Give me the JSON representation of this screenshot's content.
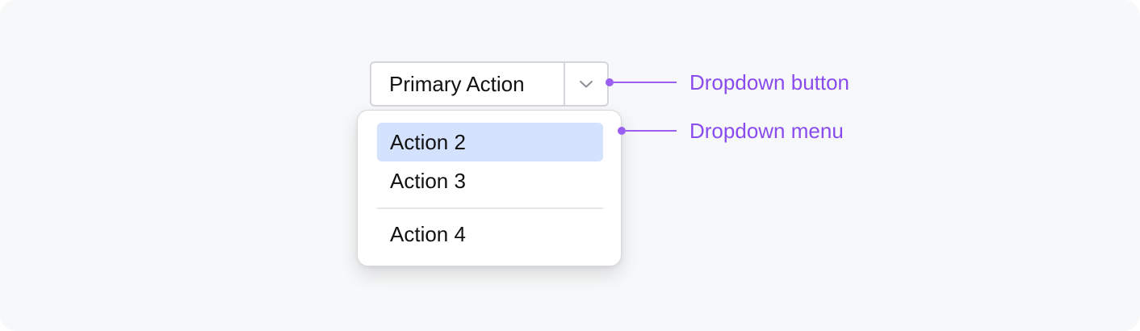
{
  "split_button": {
    "primary_label": "Primary Action",
    "toggle_icon": "chevron-down-icon"
  },
  "menu": {
    "items": [
      {
        "label": "Action 2",
        "active": true
      },
      {
        "label": "Action 3",
        "active": false
      },
      {
        "label": "Action 4",
        "active": false
      }
    ]
  },
  "callouts": {
    "button_label": "Dropdown button",
    "menu_label": "Dropdown menu"
  },
  "colors": {
    "accent": "#8a4bec",
    "active_item_bg": "#d4e2fd",
    "border": "#d4d6db",
    "canvas_bg": "#f7f8f9"
  }
}
